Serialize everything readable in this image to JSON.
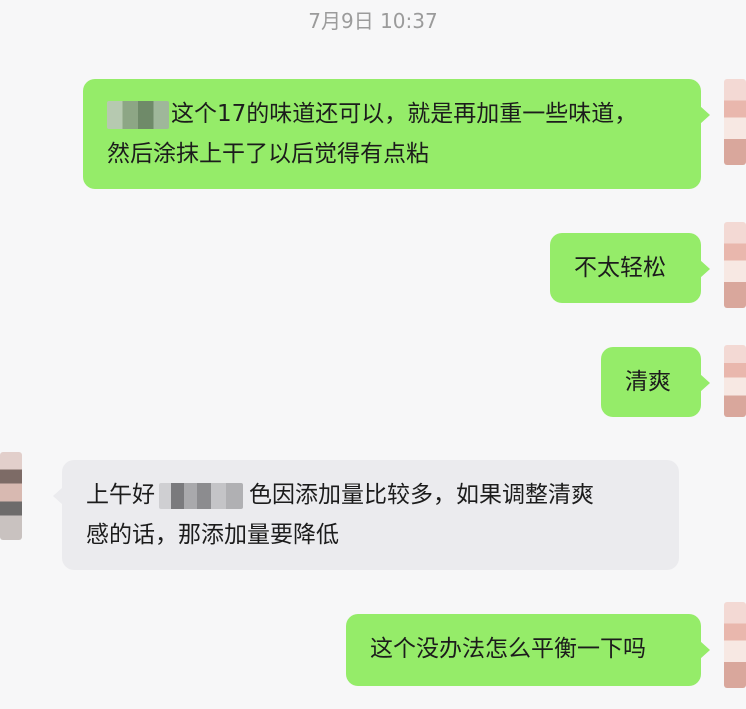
{
  "chat": {
    "timestamp": "7月9日 10:37",
    "messages": [
      {
        "sender": "self",
        "lines": [
          "这个17的味道还可以，就是再加重一些味道，",
          "然后涂抹上干了以后觉得有点粘"
        ]
      },
      {
        "sender": "self",
        "lines": [
          "不太轻松"
        ]
      },
      {
        "sender": "self",
        "lines": [
          "清爽"
        ]
      },
      {
        "sender": "other",
        "lines": [
          "上午好",
          "色因添加量比较多，如果调整清爽",
          "感的话，那添加量要降低"
        ]
      },
      {
        "sender": "self",
        "lines": [
          "这个没办法怎么平衡一下吗"
        ]
      }
    ]
  },
  "colors": {
    "outgoing_bubble": "#95ec69",
    "incoming_bubble": "#ebebee",
    "background": "#f7f7f8",
    "timestamp_text": "#9b9b9b"
  },
  "icons": {
    "avatar_self": "pixelated-avatar-icon",
    "avatar_other": "pixelated-avatar-icon"
  }
}
